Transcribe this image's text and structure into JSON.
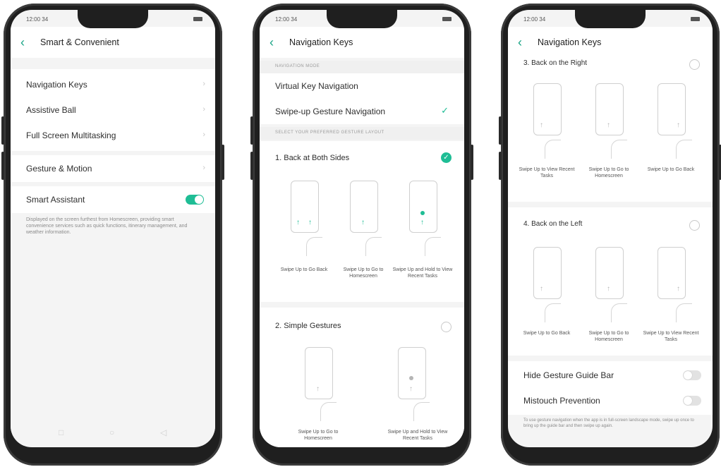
{
  "status": {
    "time": "12:00 34"
  },
  "screen1": {
    "title": "Smart & Convenient",
    "items": [
      {
        "label": "Navigation Keys"
      },
      {
        "label": "Assistive Ball"
      },
      {
        "label": "Full Screen Multitasking"
      },
      {
        "label": "Gesture & Motion"
      }
    ],
    "smart_assistant": {
      "label": "Smart Assistant",
      "enabled": true
    },
    "caption": "Displayed on the screen furthest from Homescreen, providing smart convenience services such as quick functions, itinerary management, and weather information.",
    "nav_buttons": [
      "□",
      "○",
      "◁"
    ]
  },
  "screen2": {
    "title": "Navigation Keys",
    "navigation_mode_header": "NAVIGATION MODE",
    "modes": [
      {
        "label": "Virtual Key Navigation",
        "selected": false
      },
      {
        "label": "Swipe-up Gesture Navigation",
        "selected": true
      }
    ],
    "layout_header": "SELECT YOUR PREFERRED GESTURE LAYOUT",
    "layouts": [
      {
        "label": "1. Back at Both Sides",
        "selected": true,
        "captions": [
          "Swipe Up to Go Back",
          "Swipe Up to Go to Homescreen",
          "Swipe Up and Hold to View Recent Tasks"
        ]
      },
      {
        "label": "2. Simple Gestures",
        "selected": false,
        "captions": [
          "Swipe Up to Go to Homescreen",
          "Swipe Up and Hold to View Recent Tasks"
        ]
      }
    ],
    "check_icon": "✓"
  },
  "screen3": {
    "title": "Navigation Keys",
    "layouts": [
      {
        "label": "3. Back on the Right",
        "selected": false,
        "captions": [
          "Swipe Up to View Recent Tasks",
          "Swipe Up to Go to Homescreen",
          "Swipe Up to Go Back"
        ]
      },
      {
        "label": "4. Back on the Left",
        "selected": false,
        "captions": [
          "Swipe Up to Go Back",
          "Swipe Up to Go to Homescreen",
          "Swipe Up to View Recent Tasks"
        ]
      }
    ],
    "hide_gesture_bar": {
      "label": "Hide Gesture Guide Bar",
      "enabled": false
    },
    "mistouch": {
      "label": "Mistouch Prevention",
      "enabled": false
    },
    "caption": "To use gesture navigation when the app is in full-screen landscape mode, swipe up once to bring up the guide bar and then swipe up again."
  },
  "icons": {
    "back": "back-chevron-icon",
    "chevron": "chevron-right-icon",
    "arrow": "↑"
  },
  "colors": {
    "accent": "#1fbd95",
    "frame": "#1f1f1f",
    "background": "#f4f4f4"
  }
}
